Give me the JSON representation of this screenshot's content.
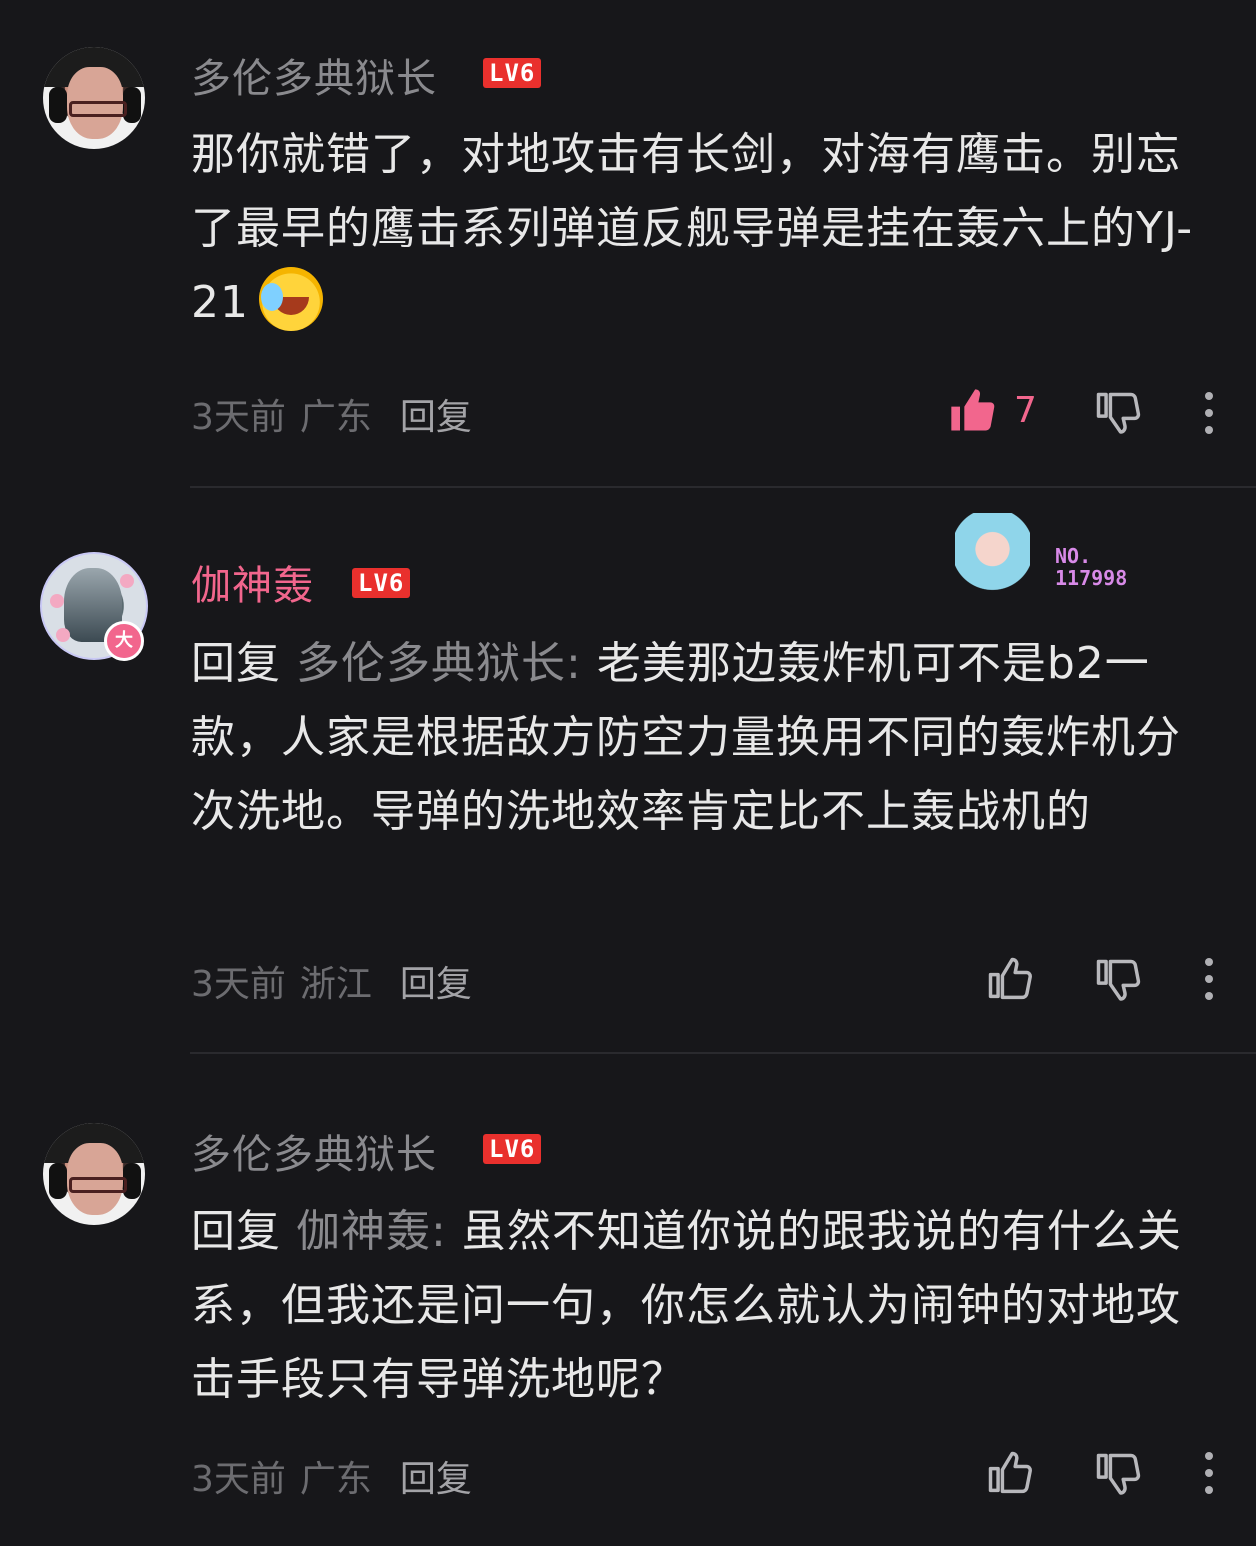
{
  "comments": [
    {
      "username": "多伦多典狱长",
      "level": "LV6",
      "text": "那你就错了，对地攻击有长剑，对海有鹰击。别忘了最早的鹰击系列弹道反舰导弹是挂在轰六上的YJ-21",
      "emoji": "laughing-crying-emoji",
      "time": "3天前",
      "location": "广东",
      "reply_label": "回复",
      "likes": "7",
      "liked": true
    },
    {
      "username": "伽神轰",
      "level": "LV6",
      "vip_badge": "大",
      "card_no": "NO.\n117998",
      "reply_prefix": "回复",
      "reply_target": "多伦多典狱长:",
      "text": "老美那边轰炸机可不是b2一款，人家是根据敌方防空力量换用不同的轰炸机分次洗地。导弹的洗地效率肯定比不上轰战机的",
      "time": "3天前",
      "location": "浙江",
      "reply_label": "回复",
      "liked": false
    },
    {
      "username": "多伦多典狱长",
      "level": "LV6",
      "reply_prefix": "回复",
      "reply_target": "伽神轰:",
      "text": "虽然不知道你说的跟我说的有什么关系，但我还是问一句，你怎么就认为闹钟的对地攻击手段只有导弹洗地呢？",
      "time": "3天前",
      "location": "广东",
      "reply_label": "回复",
      "liked": false
    }
  ],
  "colors": {
    "background": "#17171a",
    "accent_pink": "#f2668d",
    "level_red": "#e9302d"
  },
  "icons": [
    "thumbs-up-icon",
    "thumbs-down-icon",
    "more-vertical-icon"
  ]
}
